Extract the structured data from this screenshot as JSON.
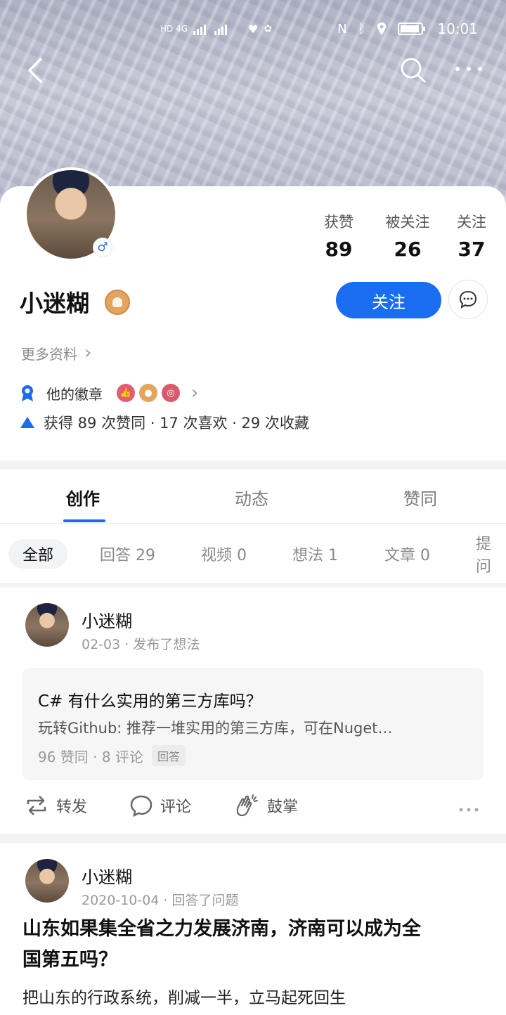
{
  "status_bar": {
    "time": "10:01",
    "left_text": "HD 4G"
  },
  "profile": {
    "name": "小迷糊",
    "gender_symbol": "♂",
    "stats": [
      {
        "label": "获赞",
        "value": "89"
      },
      {
        "label": "被关注",
        "value": "26"
      },
      {
        "label": "关注",
        "value": "37"
      }
    ],
    "follow_label": "关注",
    "more_info_label": "更多资料",
    "badges_label": "他的徽章",
    "achievement_text": "获得 89 次赞同 · 17 次喜欢 · 29 次收藏"
  },
  "tabs": [
    {
      "label": "创作"
    },
    {
      "label": "动态"
    },
    {
      "label": "赞同"
    }
  ],
  "filters": [
    {
      "label": "全部"
    },
    {
      "label": "回答 29"
    },
    {
      "label": "视频 0"
    },
    {
      "label": "想法 1"
    },
    {
      "label": "文章 0"
    },
    {
      "label": "提问"
    }
  ],
  "feed": [
    {
      "author": "小迷糊",
      "meta": "02-03 · 发布了想法",
      "quote": {
        "title": "C# 有什么实用的第三方库吗？",
        "excerpt": "玩转Github: 推荐一堆实用的第三方库，可在Nuget…",
        "meta": "96 赞同 · 8 评论",
        "tag": "回答"
      },
      "actions": {
        "repost": "转发",
        "comment": "评论",
        "applaud": "鼓掌"
      }
    },
    {
      "author": "小迷糊",
      "meta": "2020-10-04 · 回答了问题",
      "title_line1": "山东如果集全省之力发展济南，济南可以成为全",
      "title_line2": "国第五吗？",
      "body": "把山东的行政系统，削减一半，立马起死回生"
    }
  ],
  "colors": {
    "accent": "#1a6cf0"
  }
}
